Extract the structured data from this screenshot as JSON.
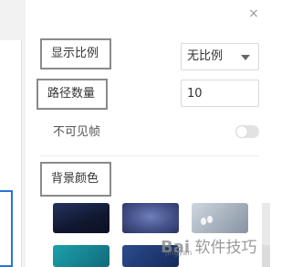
{
  "dialog": {
    "close_glyph": "×"
  },
  "ratio": {
    "label": "显示比例",
    "selected": "无比例"
  },
  "path_count": {
    "label": "路径数量",
    "value": "10"
  },
  "invisible_frame": {
    "label": "不可见帧",
    "enabled": false
  },
  "background_color": {
    "label": "背景颜色",
    "swatches": [
      {
        "name": "dark-navy",
        "color": "#10172f"
      },
      {
        "name": "indigo-glow",
        "color": "#44508a"
      },
      {
        "name": "silver-gray",
        "color": "#aab4c0"
      },
      {
        "name": "teal",
        "color": "#16808f"
      },
      {
        "name": "deep-blue",
        "color": "#1e3770"
      }
    ]
  },
  "watermark": {
    "logo": "Bai",
    "text": "软件技巧",
    "small": "jingyan"
  }
}
